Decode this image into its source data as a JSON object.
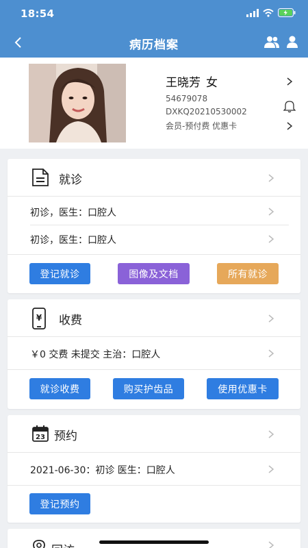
{
  "status": {
    "time": "18:54"
  },
  "nav": {
    "title": "病历档案"
  },
  "profile": {
    "name": "王晓芳",
    "gender": "女",
    "phone": "54679078",
    "record_no": "DXKQ20210530002",
    "member": "会员-预付费 优惠卡"
  },
  "visits": {
    "title": "就诊",
    "rows": [
      "初诊，医生：口腔人",
      "初诊，医生：口腔人"
    ],
    "buttons": [
      "登记就诊",
      "图像及文档",
      "所有就诊"
    ]
  },
  "fees": {
    "title": "收费",
    "row": "￥0 交费 未提交 主治：口腔人",
    "buttons": [
      "就诊收费",
      "购买护齿品",
      "使用优惠卡"
    ]
  },
  "appointments": {
    "title": "预约",
    "icon_day": "23",
    "row": "2021-06-30：初诊 医生：口腔人",
    "button": "登记预约"
  },
  "followup": {
    "title": "回访"
  },
  "icons": {
    "back": "chevron-left-icon",
    "header_right": [
      "group-icon",
      "user-icon"
    ],
    "bell": "bell-icon",
    "visits": "document-icon",
    "fees": "phone-yen-icon",
    "appointments": "calendar-icon",
    "followup": "location-icon"
  },
  "colors": {
    "header": "#4d8fd0",
    "primary_button": "#2f7de1",
    "documents_button": "#8a62d8",
    "all_visits_button": "#e6a85a",
    "background": "#eef0f3"
  }
}
